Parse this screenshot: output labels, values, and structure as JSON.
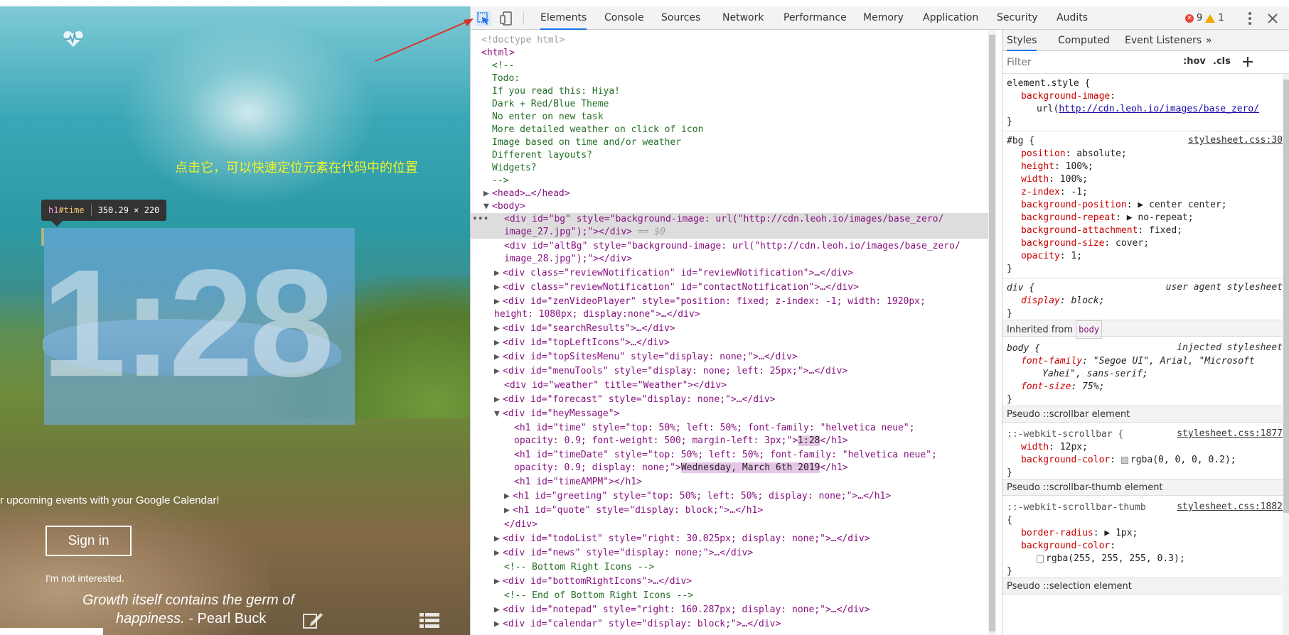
{
  "preview": {
    "annotation_text": "点击它，可以快速定位元素在代码中的位置",
    "tooltip_selector_tag": "h1",
    "tooltip_selector_id": "#time",
    "tooltip_size": "350.29 × 220",
    "time": "1:28",
    "calendar_text": "r upcoming events with your Google Calendar!",
    "signin_label": "Sign in",
    "not_interested": "I'm not interested.",
    "quote_line1": "Growth itself contains the germ of",
    "quote_line2_text": "happiness.",
    "quote_author": " - Pearl Buck"
  },
  "toolbar": {
    "tabs": [
      "Elements",
      "Console",
      "Sources",
      "Network",
      "Performance",
      "Memory",
      "Application",
      "Security",
      "Audits"
    ],
    "active_tab": "Elements",
    "error_count": "9",
    "warning_count": "1"
  },
  "elements": {
    "l0": "<!doctype html>",
    "l1": "<html>",
    "l2": "<!--",
    "l3": "Todo:",
    "l4": "If you read this: Hiya!",
    "l5": "Dark + Red/Blue Theme",
    "l6": "No enter on new task",
    "l7": "More detailed weather on click of icon",
    "l8": "Image based on time and/or weather",
    "l9": "Different layouts?",
    "l10": "Widgets?",
    "l11": "-->",
    "l12": "<head>…</head>",
    "l13": "<body>",
    "l14a": "<div id=\"bg\" style=\"background-image: url(\"http://cdn.leoh.io/images/base_zero/",
    "l14b": "image_27.jpg\");\"></div>",
    "l14c": " == $0",
    "l15a": "<div id=\"altBg\" style=\"background-image: url(\"http://cdn.leoh.io/images/base_zero/",
    "l15b": "image_28.jpg\");\"></div>",
    "l16": "<div class=\"reviewNotification\" id=\"reviewNotification\">…</div>",
    "l17": "<div class=\"reviewNotification\" id=\"contactNotification\">…</div>",
    "l18a": "<div id=\"zenVideoPlayer\" style=\"position: fixed; z-index: -1; width: 1920px;",
    "l18b": "height: 1080px; display:none\">…</div>",
    "l19": "<div id=\"searchResults\">…</div>",
    "l20": "<div id=\"topLeftIcons\">…</div>",
    "l21": "<div id=\"topSitesMenu\" style=\"display: none;\">…</div>",
    "l22": "<div id=\"menuTools\" style=\"display: none; left: 25px;\">…</div>",
    "l23": "<div id=\"weather\" title=\"Weather\"></div>",
    "l24": "<div id=\"forecast\" style=\"display: none;\">…</div>",
    "l25": "<div id=\"heyMessage\">",
    "l26a": "<h1 id=\"time\" style=\"top: 50%; left: 50%; font-family: \"helvetica neue\";",
    "l26b1": "opacity: 0.9; font-weight: 500; margin-left: 3px;\">",
    "l26b2": "1:28",
    "l26b3": "</h1>",
    "l27a": "<h1 id=\"timeDate\" style=\"top: 50%; left: 50%; font-family: \"helvetica neue\";",
    "l27b1": "opacity: 0.9; display: none;\">",
    "l27b2": "Wednesday, March 6th 2019",
    "l27b3": "</h1>",
    "l28": "<h1 id=\"timeAMPM\"></h1>",
    "l29": "<h1 id=\"greeting\" style=\"top: 50%; left: 50%; display: none;\">…</h1>",
    "l30": "<h1 id=\"quote\" style=\"display: block;\">…</h1>",
    "l31": "</div>",
    "l32": "<div id=\"todoList\" style=\"right: 30.025px; display: none;\">…</div>",
    "l33": "<div id=\"news\" style=\"display: none;\">…</div>",
    "l34": "<!-- Bottom Right Icons -->",
    "l35": "<div id=\"bottomRightIcons\">…</div>",
    "l36": "<!-- End of Bottom Right Icons -->",
    "l37": "<div id=\"notepad\" style=\"right: 160.287px; display: none;\">…</div>",
    "l38": "<div id=\"calendar\" style=\"display: block;\">…</div>"
  },
  "styles": {
    "tabs": [
      "Styles",
      "Computed",
      "Event Listeners"
    ],
    "more": "»",
    "filter_placeholder": "Filter",
    "hov": ":hov",
    "cls": ".cls",
    "el_style_sel": "element.style {",
    "el_style_prop": "background-image",
    "el_style_val_pre": "url(",
    "el_style_url": "http://cdn.leoh.io/images/base_zero/",
    "close": "}",
    "bg_sel": "#bg {",
    "bg_src": "stylesheet.css:30",
    "bg_props": [
      [
        "position",
        "absolute"
      ],
      [
        "height",
        "100%"
      ],
      [
        "width",
        "100%"
      ],
      [
        "z-index",
        "-1"
      ],
      [
        "background-position",
        "center center"
      ],
      [
        "background-repeat",
        "no-repeat"
      ],
      [
        "background-attachment",
        "fixed"
      ],
      [
        "background-size",
        "cover"
      ],
      [
        "opacity",
        "1"
      ]
    ],
    "div_sel": "div {",
    "div_src": "user agent stylesheet",
    "div_prop": "display",
    "div_val": "block",
    "inherited_label": "Inherited from",
    "inherited_tag": "body",
    "body_sel": "body {",
    "body_src": "injected stylesheet",
    "body_ff_prop": "font-family",
    "body_ff_val1": "\"Segoe UI\", Arial, \"Microsoft",
    "body_ff_val2": "Yahei\", sans-serif;",
    "body_fs_prop": "font-size",
    "body_fs_val": "75%",
    "pseudo1": "Pseudo ::scrollbar element",
    "sb_sel": "::-webkit-scrollbar {",
    "sb_src": "stylesheet.css:1877",
    "sb_w_prop": "width",
    "sb_w_val": "12px",
    "sb_bg_prop": "background-color",
    "sb_bg_val": "rgba(0, 0, 0, 0.2)",
    "pseudo2": "Pseudo ::scrollbar-thumb element",
    "sbt_sel": "::-webkit-scrollbar-thumb",
    "sbt_src": "stylesheet.css:1882",
    "sbt_open": "{",
    "sbt_br_prop": "border-radius",
    "sbt_br_val": "1px",
    "sbt_bg_prop": "background-color",
    "sbt_bg_val": "rgba(255, 255, 255, 0.3)",
    "pseudo3": "Pseudo ::selection element"
  }
}
